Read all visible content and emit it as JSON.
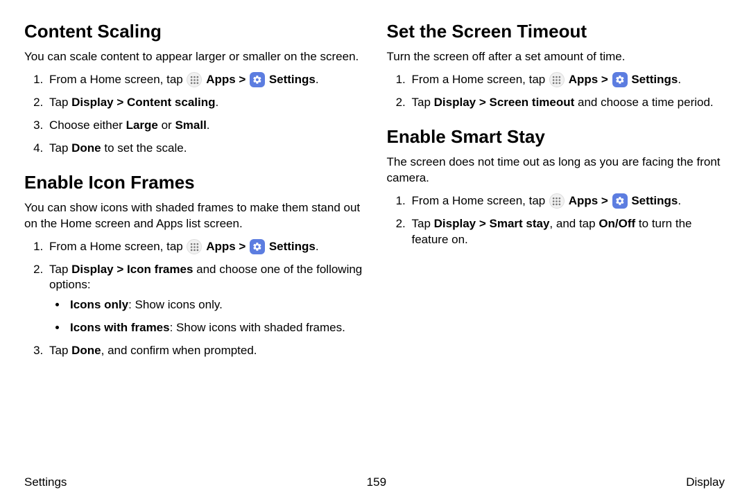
{
  "left": {
    "h1": "Content Scaling",
    "p1": "You can scale content to appear larger or smaller on the screen.",
    "list1": {
      "i1a": "From a Home screen, tap ",
      "i1_apps": "Apps",
      "i1_arrow": " > ",
      "i1_settings": "Settings",
      "i1_dot": ".",
      "i2a": "Tap ",
      "i2b": "Display > Content scaling",
      "i2c": ".",
      "i3a": "Choose either ",
      "i3b": "Large",
      "i3c": " or ",
      "i3d": "Small",
      "i3e": ".",
      "i4a": "Tap ",
      "i4b": "Done",
      "i4c": " to set the scale."
    },
    "h2": "Enable Icon Frames",
    "p2": "You can show icons with shaded frames to make them stand out on the Home screen and Apps list screen.",
    "list2": {
      "i1a": "From a Home screen, tap ",
      "i1_apps": "Apps",
      "i1_arrow": " > ",
      "i1_settings": "Settings",
      "i1_dot": ".",
      "i2a": "Tap ",
      "i2b": "Display > Icon frames",
      "i2c": " and choose one of the following options:",
      "b1a": "Icons only",
      "b1b": ": Show icons only.",
      "b2a": "Icons with frames",
      "b2b": ": Show icons with shaded frames.",
      "i3a": "Tap ",
      "i3b": "Done",
      "i3c": ", and confirm when prompted."
    }
  },
  "right": {
    "h1": "Set the Screen Timeout",
    "p1": "Turn the screen off after a set amount of time.",
    "list1": {
      "i1a": "From a Home screen, tap ",
      "i1_apps": "Apps",
      "i1_arrow": " > ",
      "i1_settings": "Settings",
      "i1_dot": ".",
      "i2a": "Tap ",
      "i2b": "Display > Screen timeout",
      "i2c": " and choose a time period."
    },
    "h2": "Enable Smart Stay",
    "p2": "The screen does not time out as long as you are facing the front camera.",
    "list2": {
      "i1a": "From a Home screen, tap ",
      "i1_apps": "Apps",
      "i1_arrow": " > ",
      "i1_settings": "Settings",
      "i1_dot": ".",
      "i2a": "Tap ",
      "i2b": "Display > Smart stay",
      "i2c": ", and tap ",
      "i2d": "On/Off",
      "i2e": " to turn the feature on."
    }
  },
  "footer": {
    "left": "Settings",
    "center": "159",
    "right": "Display"
  }
}
